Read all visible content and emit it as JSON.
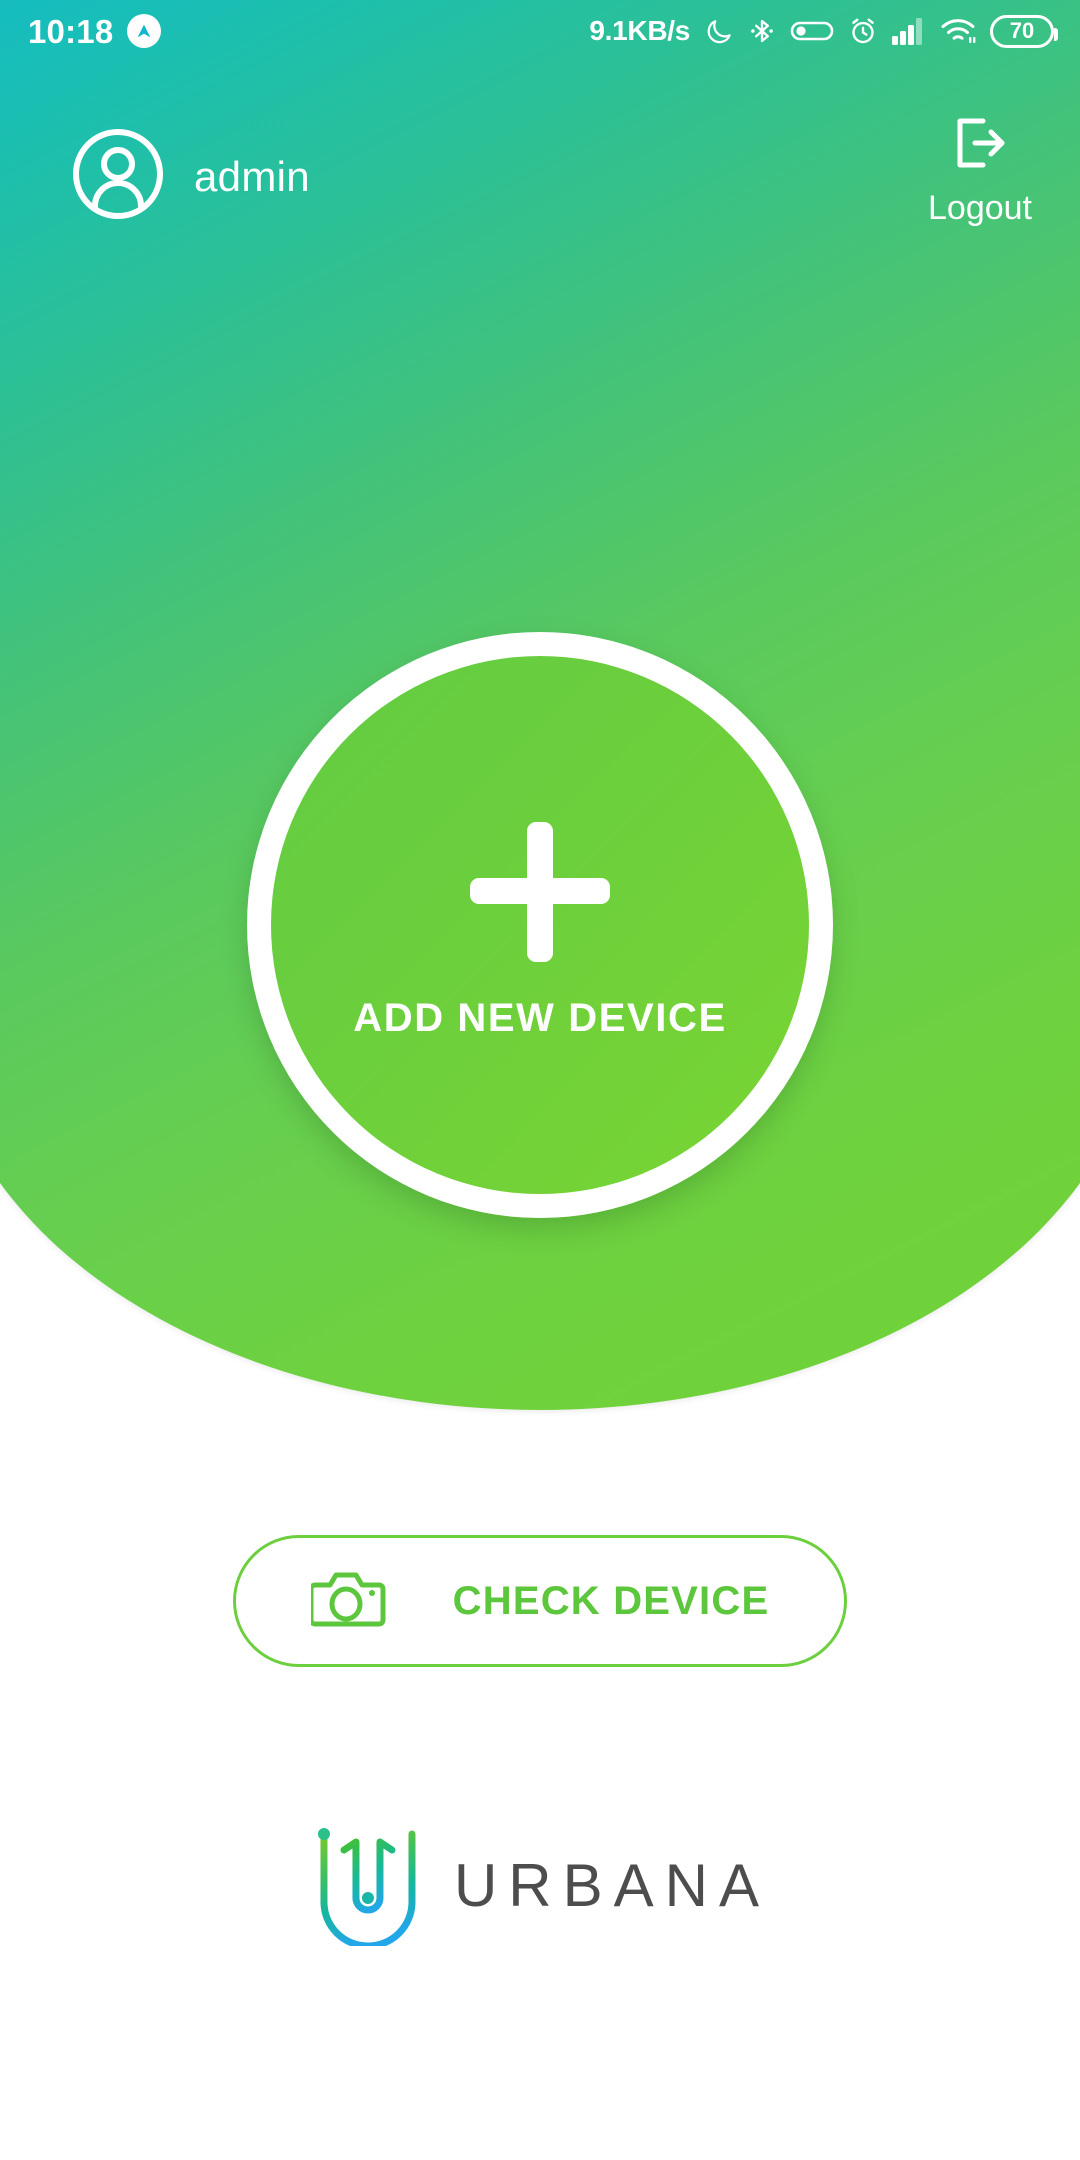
{
  "status_bar": {
    "time": "10:18",
    "notification_icon": "app-caret-icon",
    "network_speed": "9.1KB/s",
    "icons": [
      "do-not-disturb-moon-icon",
      "bluetooth-icon",
      "vpn-key-icon",
      "alarm-clock-icon",
      "cellular-signal-icon",
      "wifi-icon"
    ],
    "battery_level": "70"
  },
  "header": {
    "avatar_icon": "user-avatar-icon",
    "username": "admin",
    "logout_icon": "logout-arrow-icon",
    "logout_label": "Logout"
  },
  "main": {
    "add_device": {
      "icon": "plus-icon",
      "label": "ADD NEW DEVICE"
    },
    "check_device": {
      "icon": "camera-icon",
      "label": "CHECK DEVICE"
    }
  },
  "footer": {
    "logo_mark": "urbana-u-mark",
    "brand": "URBANA"
  },
  "colors": {
    "gradient_start": "#07b3e4",
    "gradient_mid": "#1cbfae",
    "gradient_end": "#72d335",
    "accent_green": "#6ccf3e",
    "check_text_green": "#5cc63c",
    "brand_text": "#4d4d4d",
    "white": "#ffffff"
  }
}
